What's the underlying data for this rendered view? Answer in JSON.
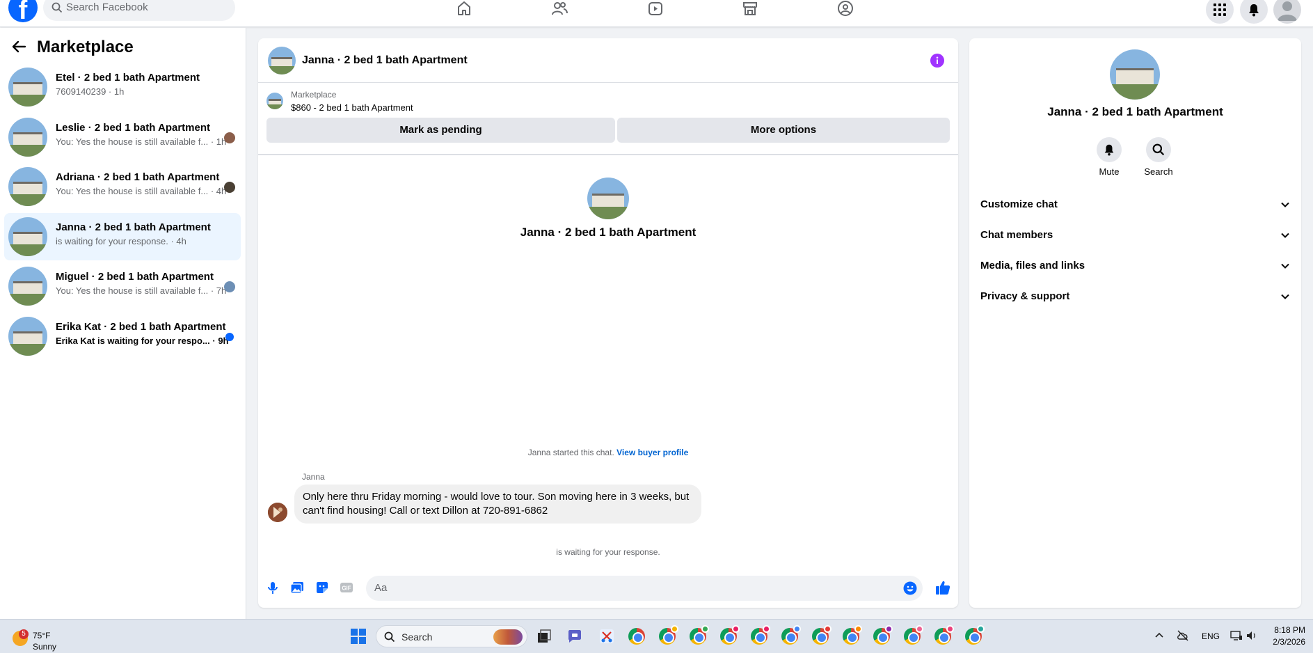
{
  "topbar": {
    "search_placeholder": "Search Facebook"
  },
  "left": {
    "title": "Marketplace",
    "conversations": [
      {
        "name": "Etel · 2 bed 1 bath Apartment",
        "sub": "7609140239 · 1h"
      },
      {
        "name": "Leslie · 2 bed 1 bath Apartment",
        "sub": "You: Yes the house is still available f... · 1h"
      },
      {
        "name": "Adriana · 2 bed 1 bath Apartment",
        "sub": "You: Yes the house is still available f... · 4h"
      },
      {
        "name": "Janna · 2 bed 1 bath Apartment",
        "sub": "is waiting for your response. · 4h"
      },
      {
        "name": "Miguel · 2 bed 1 bath Apartment",
        "sub": "You: Yes the house is still available f... · 7h"
      },
      {
        "name": "Erika Kat · 2 bed 1 bath Apartment",
        "sub": "Erika Kat is waiting for your respo... · 9h"
      }
    ]
  },
  "chat": {
    "title": "Janna · 2 bed 1 bath Apartment",
    "listing_source": "Marketplace",
    "listing_price": "$860 - 2 bed 1 bath Apartment",
    "btn_pending": "Mark as pending",
    "btn_more": "More options",
    "center_title": "Janna · 2 bed 1 bath Apartment",
    "started_text": "Janna started this chat.",
    "started_link": "View buyer profile",
    "sender": "Janna",
    "message": "Only here thru Friday morning - would love to tour.  Son moving here in 3 weeks, but can't find housing!  Call or text Dillon at 720-891-6862",
    "waiting": "is waiting for your response.",
    "composer_placeholder": "Aa"
  },
  "right": {
    "title": "Janna · 2 bed 1 bath Apartment",
    "mute_label": "Mute",
    "search_label": "Search",
    "sections": [
      "Customize chat",
      "Chat members",
      "Media, files and links",
      "Privacy & support"
    ]
  },
  "taskbar": {
    "weather_badge": "5",
    "temp": "75°F",
    "condition": "Sunny",
    "search_placeholder": "Search",
    "lang": "ENG",
    "time": "8:18 PM",
    "date": "2/3/2026"
  },
  "colors": {
    "brand": "#0866ff",
    "accent_purple": "#a033ff",
    "active_row": "#ebf5ff"
  }
}
